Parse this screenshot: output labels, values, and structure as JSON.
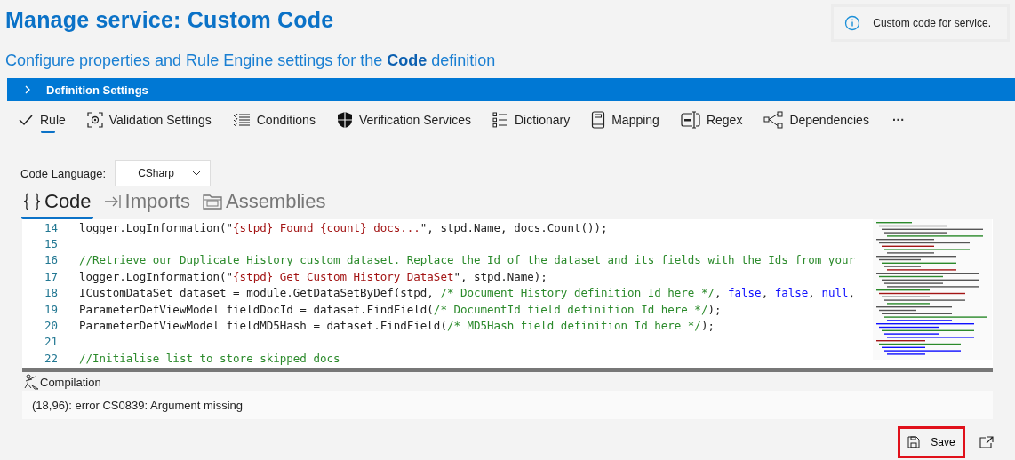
{
  "title": "Manage service:  Custom Code",
  "subtitle": "Configure properties and Rule Engine settings for the **Code** definition",
  "info_tip": {
    "text": "Custom code for service."
  },
  "section": {
    "label": "Definition Settings",
    "expanded": false
  },
  "tabs": [
    {
      "label": "Rule",
      "selected": true
    },
    {
      "label": "Validation Settings",
      "selected": false
    },
    {
      "label": "Conditions",
      "selected": false
    },
    {
      "label": "Verification Services",
      "selected": false
    },
    {
      "label": "Dictionary",
      "selected": false
    },
    {
      "label": "Mapping",
      "selected": false
    },
    {
      "label": "Regex",
      "selected": false
    },
    {
      "label": "Dependencies",
      "selected": false
    }
  ],
  "more": "···",
  "language": {
    "label": "Code Language:",
    "value": "CSharp"
  },
  "code_tabs": [
    {
      "label": "Code",
      "selected": true
    },
    {
      "label": "Imports",
      "selected": false
    },
    {
      "label": "Assemblies",
      "selected": false
    }
  ],
  "code_lines": [
    {
      "number": "14",
      "segments": [
        {
          "kind": "plain",
          "text": "logger.LogInformation(\""
        },
        {
          "kind": "string",
          "text": "{stpd} Found {count} docs..."
        },
        {
          "kind": "plain",
          "text": "\", stpd.Name, docs.Count());"
        }
      ]
    },
    {
      "number": "15"
    },
    {
      "number": "16",
      "segments": [
        {
          "kind": "comment",
          "text": "//Retrieve our Duplicate History custom dataset. Replace the Id of the dataset and its fields with the Ids from your"
        }
      ]
    },
    {
      "number": "17",
      "segments": [
        {
          "kind": "plain",
          "text": "logger.LogInformation(\""
        },
        {
          "kind": "string",
          "text": "{stpd} Get Custom History DataSet"
        },
        {
          "kind": "plain",
          "text": "\", stpd.Name);"
        }
      ]
    },
    {
      "number": "18",
      "segments": [
        {
          "kind": "plain",
          "text": "ICustomDataSet dataset = module.GetDataSetByDef(stpd, "
        },
        {
          "kind": "comment",
          "text": "/* Document History definition Id here */"
        },
        {
          "kind": "plain",
          "text": ", "
        },
        {
          "kind": "keyword",
          "text": "false"
        },
        {
          "kind": "plain",
          "text": ", "
        },
        {
          "kind": "keyword",
          "text": "false"
        },
        {
          "kind": "plain",
          "text": ", "
        },
        {
          "kind": "keyword",
          "text": "null"
        },
        {
          "kind": "plain",
          "text": ","
        }
      ]
    },
    {
      "number": "19",
      "segments": [
        {
          "kind": "plain",
          "text": "ParameterDefViewModel fieldDocId = dataset.FindField("
        },
        {
          "kind": "comment",
          "text": "/* DocumentId field definition Id here */"
        },
        {
          "kind": "plain",
          "text": ");"
        }
      ]
    },
    {
      "number": "20",
      "segments": [
        {
          "kind": "plain",
          "text": "ParameterDefViewModel fieldMD5Hash = dataset.FindField("
        },
        {
          "kind": "comment",
          "text": "/* MD5Hash field definition Id here */"
        },
        {
          "kind": "plain",
          "text": ");"
        }
      ]
    },
    {
      "number": "21"
    },
    {
      "number": "22",
      "segments": [
        {
          "kind": "comment",
          "text": "//Initialise list to store skipped docs"
        }
      ]
    }
  ],
  "compilation": {
    "label": "Compilation",
    "message": "(18,96): error CS0839: Argument missing"
  },
  "save": {
    "label": "Save",
    "highlighted": true
  }
}
